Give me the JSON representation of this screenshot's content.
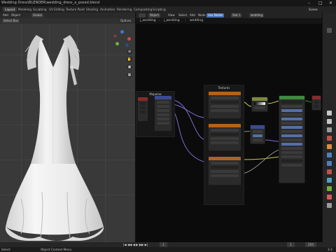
{
  "titlebar": {
    "title": "Wedding Dress\\BLENDER\\wedding_dress_a_posed.blend",
    "minimize": "–",
    "maximize": "□",
    "close": "✕"
  },
  "tabs": [
    {
      "label": "Layout",
      "active": true
    },
    {
      "label": "Modeling",
      "active": false
    },
    {
      "label": "Sculpting",
      "active": false
    },
    {
      "label": "UV Editing",
      "active": false
    },
    {
      "label": "Texture Paint",
      "active": false
    },
    {
      "label": "Shading",
      "active": false
    },
    {
      "label": "Animation",
      "active": false
    },
    {
      "label": "Rendering",
      "active": false
    },
    {
      "label": "Compositing",
      "active": false
    },
    {
      "label": "Scripting",
      "active": false
    }
  ],
  "scene_label": "Scene",
  "viewport": {
    "menu": [
      "Add",
      "Object"
    ],
    "mode": "Object",
    "shading": "Global",
    "select_box": "Select Box",
    "options": "Options"
  },
  "nodeeditor": {
    "header_menus": [
      "Object",
      "View",
      "Select",
      "Add",
      "Node"
    ],
    "use_nodes": "Use Nodes",
    "slot": "Slot 1",
    "material": "wedding",
    "breadcrumb": [
      "j_wedding",
      "j_wedding",
      "wedding"
    ],
    "frames": {
      "mapping": "Mapping",
      "textures": "Textures"
    }
  },
  "colors": {
    "accent_blue": "#4772b3",
    "wire_purple": "#7c6bd0",
    "wire_yellow": "#c9c94d",
    "wire_gray": "#8e8e8e",
    "node_red": "#8a2a2a",
    "node_orange": "#b0631c",
    "node_green": "#7c8a3a",
    "node_shader": "#3d8b3d",
    "node_blue": "#3b4a93"
  },
  "timeline": {
    "playback_controls": "|◀ ◀◀ ◀ ▶ ▶▶ ▶|",
    "current_frame": "1",
    "start": "1",
    "end": "250"
  },
  "status": {
    "left": "Select",
    "middle": "Object Context Menu",
    "version": "3.3"
  }
}
